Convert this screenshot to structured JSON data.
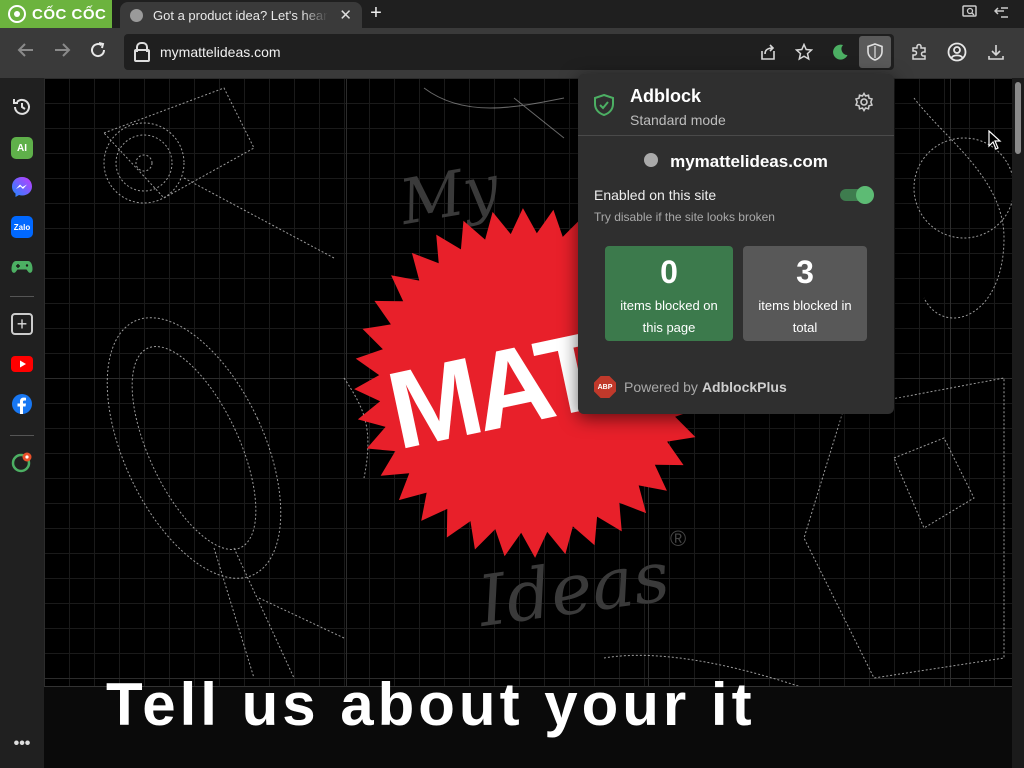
{
  "browser": {
    "brand": "CỐC CỐC",
    "tab_title": "Got a product idea? Let's hear it",
    "url": "mymattelideas.com"
  },
  "page": {
    "logo_text": "MATT",
    "my_text": "My",
    "ideas_text": "Ideas",
    "registered": "®",
    "heading": "Tell us about your it"
  },
  "popup": {
    "title": "Adblock",
    "mode": "Standard mode",
    "site": "mymattelideas.com",
    "enabled_label": "Enabled on this site",
    "hint": "Try disable if the site looks broken",
    "blocked_page": {
      "value": "0",
      "label": "items blocked on this page"
    },
    "blocked_total": {
      "value": "3",
      "label": "items blocked in total"
    },
    "powered_prefix": "Powered by",
    "powered_brand": "AdblockPlus",
    "abp_badge": "ABP",
    "toggle_on": true
  },
  "colors": {
    "brand_green": "#6cb33e",
    "stat_green": "#3c7a4c",
    "stat_gray": "#585858",
    "toggle": "#5dbb74",
    "badge_red": "#e8202a"
  },
  "icons": [
    "back-icon",
    "forward-icon",
    "reload-icon",
    "lock-icon",
    "share-icon",
    "star-icon",
    "moon-icon",
    "shield-icon",
    "puzzle-icon",
    "account-icon",
    "download-icon",
    "history-icon",
    "ai-icon",
    "messenger-icon",
    "zalo-icon",
    "game-icon",
    "plus-icon",
    "youtube-icon",
    "facebook-icon",
    "map-pin-icon",
    "more-icon",
    "gear-icon",
    "globe-icon"
  ]
}
